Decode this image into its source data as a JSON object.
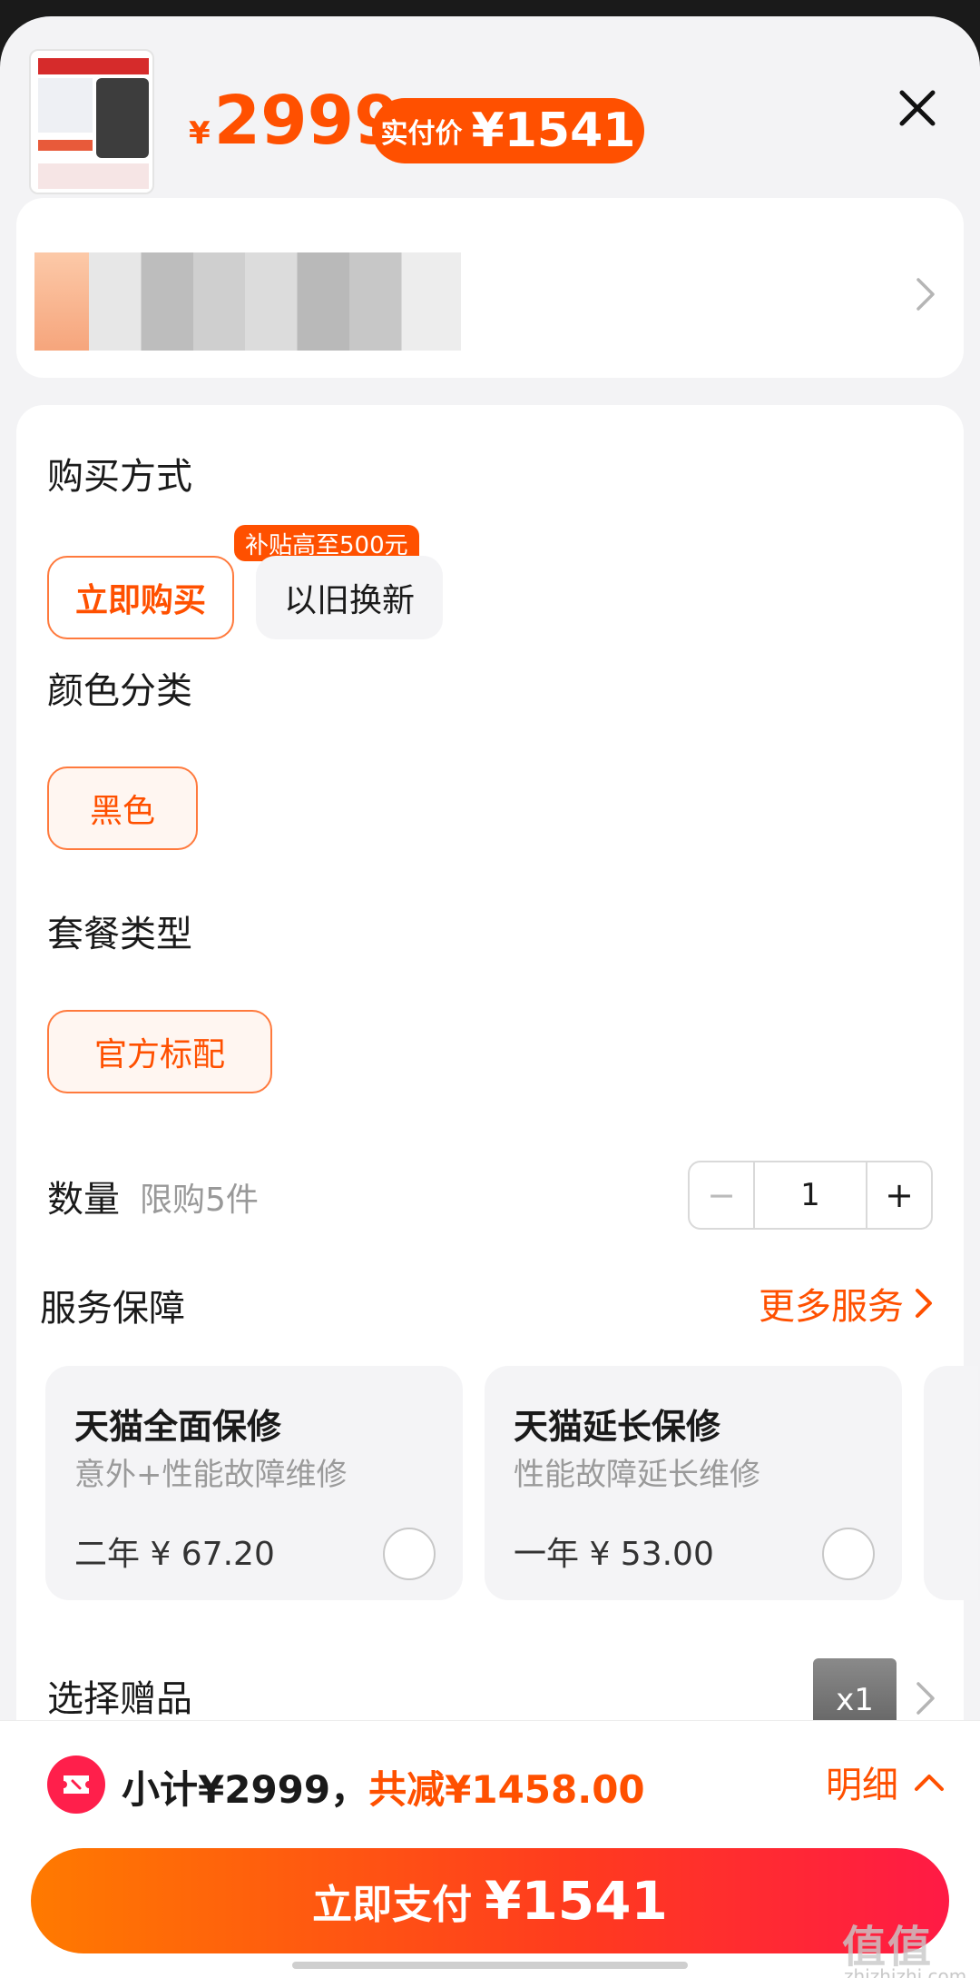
{
  "header": {
    "currency": "¥",
    "price": "2999",
    "pay_label": "实付价",
    "pay_value": "¥1541",
    "close_icon": "close-icon"
  },
  "options": {
    "buy_method": {
      "title": "购买方式",
      "choices": [
        "立即购买",
        "以旧换新"
      ],
      "subsidy_badge": "补贴高至500元"
    },
    "color": {
      "title": "颜色分类",
      "choices": [
        "黑色"
      ]
    },
    "package": {
      "title": "套餐类型",
      "choices": [
        "官方标配"
      ]
    },
    "quantity": {
      "title": "数量",
      "limit": "限购5件",
      "minus": "−",
      "value": "1",
      "plus": "+"
    },
    "service": {
      "title": "服务保障",
      "more": "更多服务",
      "cards": [
        {
          "name": "天猫全面保修",
          "desc": "意外+性能故障维修",
          "price": "二年 ¥ 67.20"
        },
        {
          "name": "天猫延长保修",
          "desc": "性能故障延长维修",
          "price": "一年 ¥ 53.00"
        }
      ]
    },
    "gift": {
      "title": "选择赠品",
      "count": "x1"
    }
  },
  "bottom": {
    "subtotal": "小计¥2999，",
    "discount": "共减¥1458.00",
    "detail": "明细",
    "pay_label": "立即支付",
    "pay_value": "¥1541"
  },
  "watermark": {
    "main": "值值值",
    "sub": "zhizhizhi.com"
  },
  "colors": {
    "accent": "#ff5000",
    "pay_gradient_start": "#ff7a00",
    "pay_gradient_end": "#ff1a45"
  }
}
